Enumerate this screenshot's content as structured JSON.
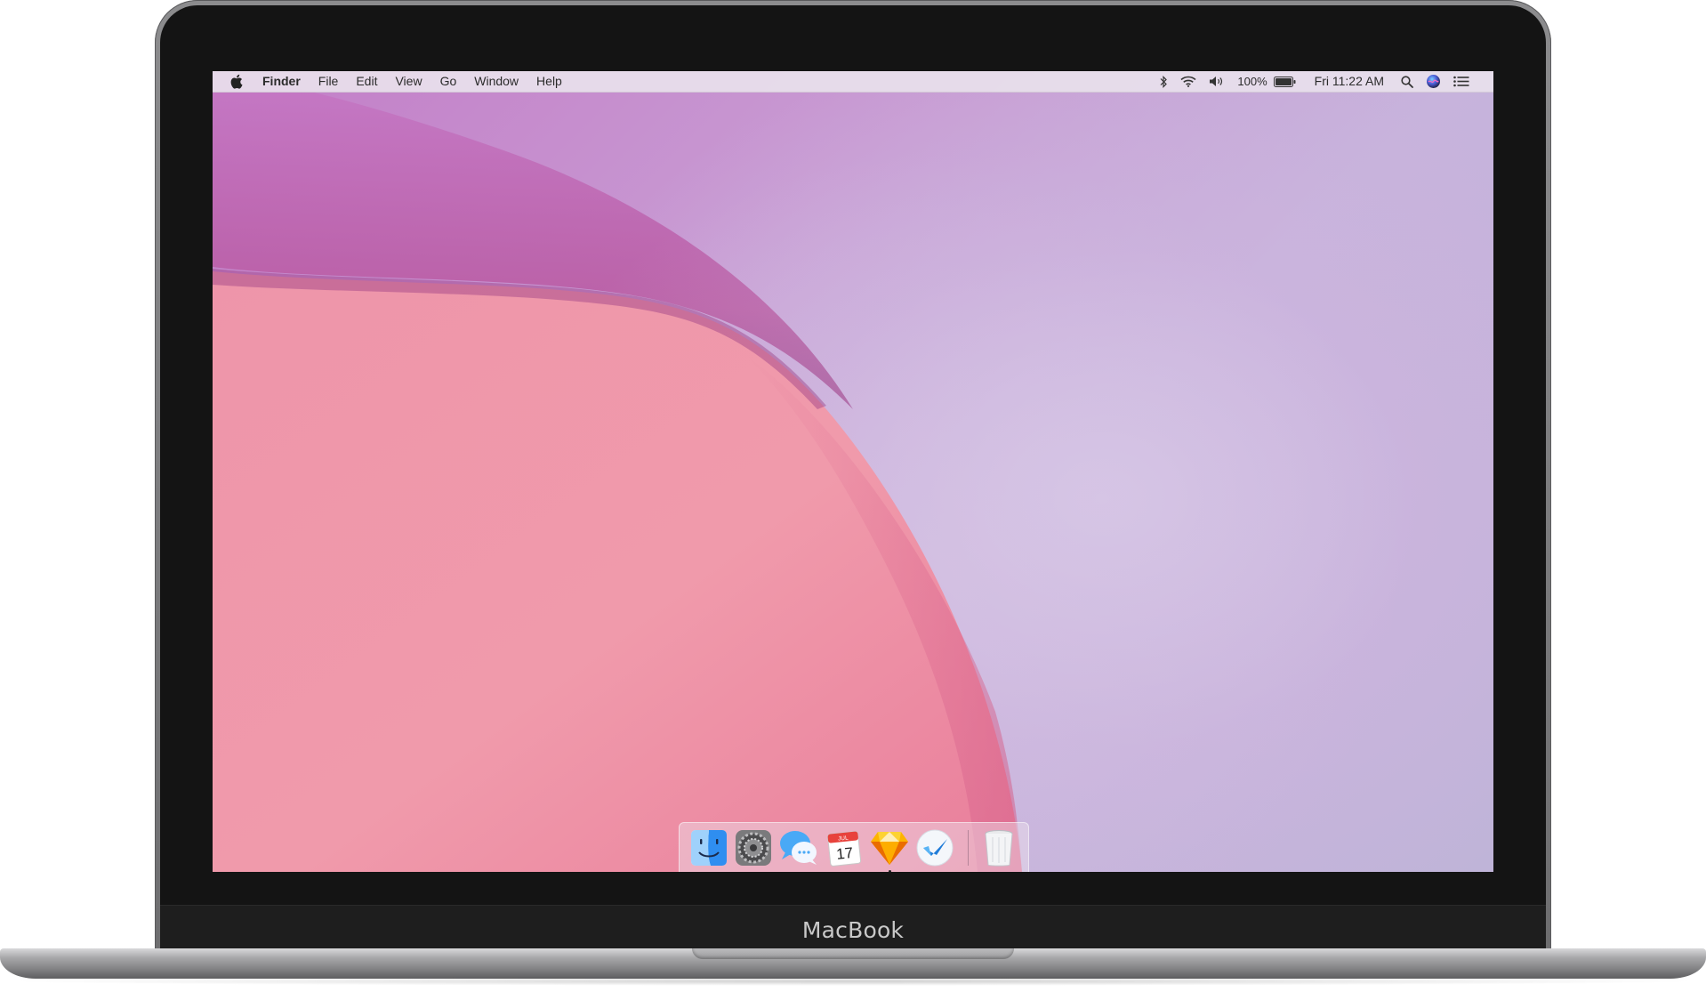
{
  "device": {
    "brand_label": "MacBook"
  },
  "menubar": {
    "apple_icon": "apple-logo-icon",
    "app_name": "Finder",
    "menus": [
      "File",
      "Edit",
      "View",
      "Go",
      "Window",
      "Help"
    ],
    "status": {
      "battery_percent": "100%",
      "clock": "Fri 11:22 AM"
    },
    "status_icons": [
      "bluetooth-icon",
      "wifi-icon",
      "volume-icon",
      "battery-icon",
      "spotlight-search-icon",
      "siri-icon",
      "notification-center-icon"
    ]
  },
  "dock": {
    "apps": [
      {
        "name": "Finder",
        "icon": "finder-icon",
        "running": false
      },
      {
        "name": "System Preferences",
        "icon": "system-preferences-icon",
        "running": false
      },
      {
        "name": "Messages",
        "icon": "messages-icon",
        "running": false
      },
      {
        "name": "Calendar",
        "icon": "calendar-icon",
        "running": false,
        "month": "JUL",
        "day": "17"
      },
      {
        "name": "Sketch",
        "icon": "sketch-icon",
        "running": true
      },
      {
        "name": "Unknown App",
        "icon": "blue-bird-icon",
        "running": false
      }
    ],
    "trash": {
      "name": "Trash",
      "icon": "trash-icon"
    }
  },
  "colors": {
    "wallpaper_pink": "#ee8fa6",
    "wallpaper_purple": "#c37dc7",
    "wallpaper_lavender": "#c7b3dc",
    "bezel": "#141414",
    "chassis": "#8c8c8e"
  }
}
